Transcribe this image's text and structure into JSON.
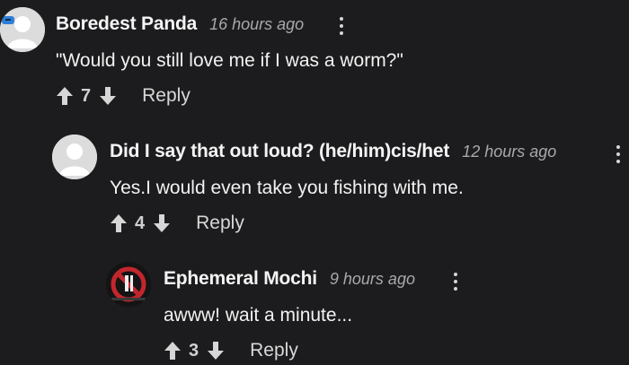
{
  "comments": [
    {
      "author": "Boredest Panda",
      "time": "16 hours ago",
      "text": "\"Would you still love me if I was a worm?\"",
      "votes": "7",
      "reply_label": "Reply",
      "avatar_icon": "default-avatar-with-badge"
    },
    {
      "author": "Did I say that out loud? (he/him)cis/het",
      "time": "12 hours ago",
      "text": "Yes.I would even take you fishing with me.",
      "votes": "4",
      "reply_label": "Reply",
      "avatar_icon": "default-avatar"
    },
    {
      "author": "Ephemeral Mochi",
      "time": "9 hours ago",
      "text": "awww! wait a minute...",
      "votes": "3",
      "reply_label": "Reply",
      "avatar_icon": "no-symbol-avatar"
    }
  ],
  "colors": {
    "background": "#1c1c1e",
    "text": "#f2f2f2",
    "muted": "#a9a9ad",
    "avatar_badge": "#2e7fd6",
    "no_symbol_red": "#c4262e"
  }
}
